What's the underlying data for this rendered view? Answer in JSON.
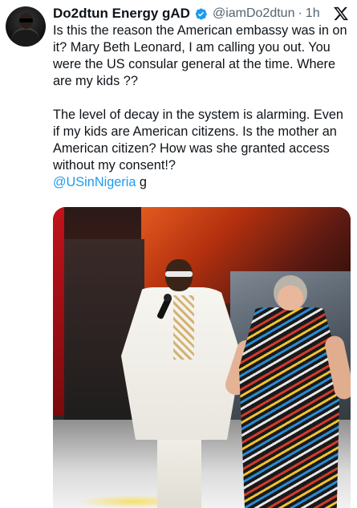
{
  "tweet": {
    "author": {
      "display_name": "Do2dtun Energy gAD",
      "handle": "@iamDo2dtun",
      "verified": true
    },
    "time": "1h",
    "separator": "·",
    "text_part1": "Is this the reason the American embassy was in on it? Mary Beth Leonard, I am calling you out. You were the US consular general at the time. Where are my kids ??\n\nThe level of decay in the system is alarming. Even if my kids are American citizens. Is the mother an American citizen? How was she granted access without my consent!?\n",
    "mention": "@USinNigeria",
    "text_suffix": " g"
  },
  "colors": {
    "link": "#1d9bf0",
    "text": "#0f1419",
    "secondary": "#536471",
    "verified_badge": "#1d9bf0"
  },
  "icons": {
    "brand": "x-logo-icon",
    "badge": "verified-badge-icon"
  }
}
